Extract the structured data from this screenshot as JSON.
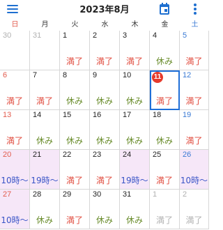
{
  "header": {
    "title": "2023年8月",
    "menu_icon": "hamburger-menu-icon",
    "calendar_icon": "calendar-icon",
    "more_icon": "more-vertical-icon",
    "accent_color": "#1e6fd0"
  },
  "weekdays": [
    {
      "label": "日",
      "kind": "sun"
    },
    {
      "label": "月",
      "kind": "wk"
    },
    {
      "label": "火",
      "kind": "wk"
    },
    {
      "label": "水",
      "kind": "wk"
    },
    {
      "label": "木",
      "kind": "wk"
    },
    {
      "label": "金",
      "kind": "wk"
    },
    {
      "label": "土",
      "kind": "sat"
    }
  ],
  "today": {
    "day": "11",
    "color": "#e63a2c",
    "outline_color": "#1f6fd8"
  },
  "weeks": [
    [
      {
        "day": "30",
        "dim": true,
        "status": "",
        "type": ""
      },
      {
        "day": "31",
        "dim": true,
        "status": "",
        "type": ""
      },
      {
        "day": "1",
        "status": "満了",
        "type": "full"
      },
      {
        "day": "2",
        "status": "満了",
        "type": "full"
      },
      {
        "day": "3",
        "status": "満了",
        "type": "full"
      },
      {
        "day": "4",
        "status": "休み",
        "type": "rest"
      },
      {
        "day": "5",
        "status": "満了",
        "type": "full"
      }
    ],
    [
      {
        "day": "6",
        "status": "満了",
        "type": "full"
      },
      {
        "day": "7",
        "status": "満了",
        "type": "full"
      },
      {
        "day": "8",
        "status": "休み",
        "type": "rest"
      },
      {
        "day": "9",
        "status": "休み",
        "type": "rest"
      },
      {
        "day": "10",
        "status": "休み",
        "type": "rest"
      },
      {
        "day": "11",
        "status": "満了",
        "type": "full",
        "today": true
      },
      {
        "day": "12",
        "status": "満了",
        "type": "full"
      }
    ],
    [
      {
        "day": "13",
        "status": "満了",
        "type": "full"
      },
      {
        "day": "14",
        "status": "休み",
        "type": "rest"
      },
      {
        "day": "15",
        "status": "休み",
        "type": "rest"
      },
      {
        "day": "16",
        "status": "休み",
        "type": "rest"
      },
      {
        "day": "17",
        "status": "休み",
        "type": "rest"
      },
      {
        "day": "18",
        "status": "休み",
        "type": "rest"
      },
      {
        "day": "19",
        "status": "満了",
        "type": "full"
      }
    ],
    [
      {
        "day": "20",
        "status": "10時〜",
        "type": "time",
        "hl": true
      },
      {
        "day": "21",
        "status": "19時〜",
        "type": "time",
        "hl": true
      },
      {
        "day": "22",
        "status": "満了",
        "type": "full"
      },
      {
        "day": "23",
        "status": "満了",
        "type": "full"
      },
      {
        "day": "24",
        "status": "19時〜",
        "type": "time",
        "hl": true
      },
      {
        "day": "25",
        "status": "満了",
        "type": "full"
      },
      {
        "day": "26",
        "status": "10時〜",
        "type": "time",
        "hl": true
      }
    ],
    [
      {
        "day": "27",
        "status": "10時〜",
        "type": "time",
        "hl": true
      },
      {
        "day": "28",
        "status": "休み",
        "type": "rest"
      },
      {
        "day": "29",
        "status": "満了",
        "type": "full"
      },
      {
        "day": "30",
        "status": "休み",
        "type": "rest"
      },
      {
        "day": "31",
        "status": "休み",
        "type": "rest"
      },
      {
        "day": "1",
        "dim": true,
        "status": "満了",
        "type": "gray"
      },
      {
        "day": "2",
        "dim": true,
        "status": "満了",
        "type": "gray"
      }
    ]
  ]
}
